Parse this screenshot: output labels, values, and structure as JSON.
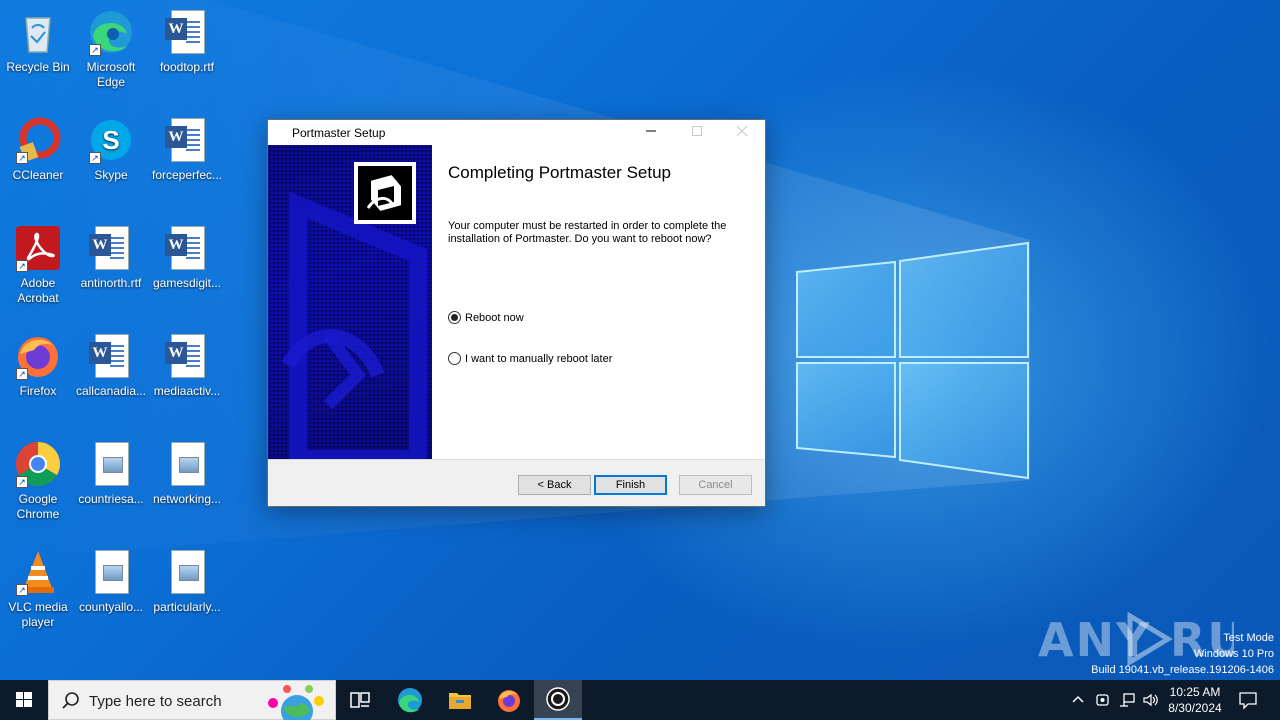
{
  "desktop": {
    "icons": [
      {
        "label": "Recycle Bin",
        "icon": "recycle-bin-icon"
      },
      {
        "label": "Microsoft Edge",
        "icon": "edge-icon"
      },
      {
        "label": "foodtop.rtf",
        "icon": "word-doc-icon"
      },
      {
        "label": "CCleaner",
        "icon": "ccleaner-icon"
      },
      {
        "label": "Skype",
        "icon": "skype-icon"
      },
      {
        "label": "forceperfec...",
        "icon": "word-doc-icon"
      },
      {
        "label": "Adobe Acrobat",
        "icon": "acrobat-icon"
      },
      {
        "label": "antinorth.rtf",
        "icon": "word-doc-icon"
      },
      {
        "label": "gamesdigit...",
        "icon": "word-doc-icon"
      },
      {
        "label": "Firefox",
        "icon": "firefox-icon"
      },
      {
        "label": "callcanadia...",
        "icon": "word-doc-icon"
      },
      {
        "label": "mediaactiv...",
        "icon": "word-doc-icon"
      },
      {
        "label": "Google Chrome",
        "icon": "chrome-icon"
      },
      {
        "label": "countriesa...",
        "icon": "image-file-icon"
      },
      {
        "label": "networking...",
        "icon": "image-file-icon"
      },
      {
        "label": "VLC media player",
        "icon": "vlc-icon"
      },
      {
        "label": "countyallo...",
        "icon": "image-file-icon"
      },
      {
        "label": "particularly...",
        "icon": "image-file-icon"
      }
    ]
  },
  "dialog": {
    "title": "Portmaster Setup",
    "heading": "Completing Portmaster Setup",
    "body": "Your computer must be restarted in order to complete the installation of Portmaster. Do you want to reboot now?",
    "options": [
      {
        "label": "Reboot now",
        "checked": true
      },
      {
        "label": "I want to manually reboot later",
        "checked": false
      }
    ],
    "buttons": {
      "back": "< Back",
      "finish": "Finish",
      "cancel": "Cancel"
    }
  },
  "watermark": {
    "line1": "Test Mode",
    "line2": "Windows 10 Pro",
    "line3": "Build 19041.vb_release.191206-1406",
    "brand": "ANY RUN"
  },
  "taskbar": {
    "search_placeholder": "Type here to search",
    "apps": [
      "task-view-icon",
      "edge-icon",
      "file-explorer-icon",
      "firefox-icon",
      "portmaster-icon"
    ],
    "clock": {
      "time": "10:25 AM",
      "date": "8/30/2024"
    }
  },
  "colors": {
    "accent": "#0078d7",
    "taskbar": "#0c1a2a",
    "banner": "#0a0a8a"
  }
}
